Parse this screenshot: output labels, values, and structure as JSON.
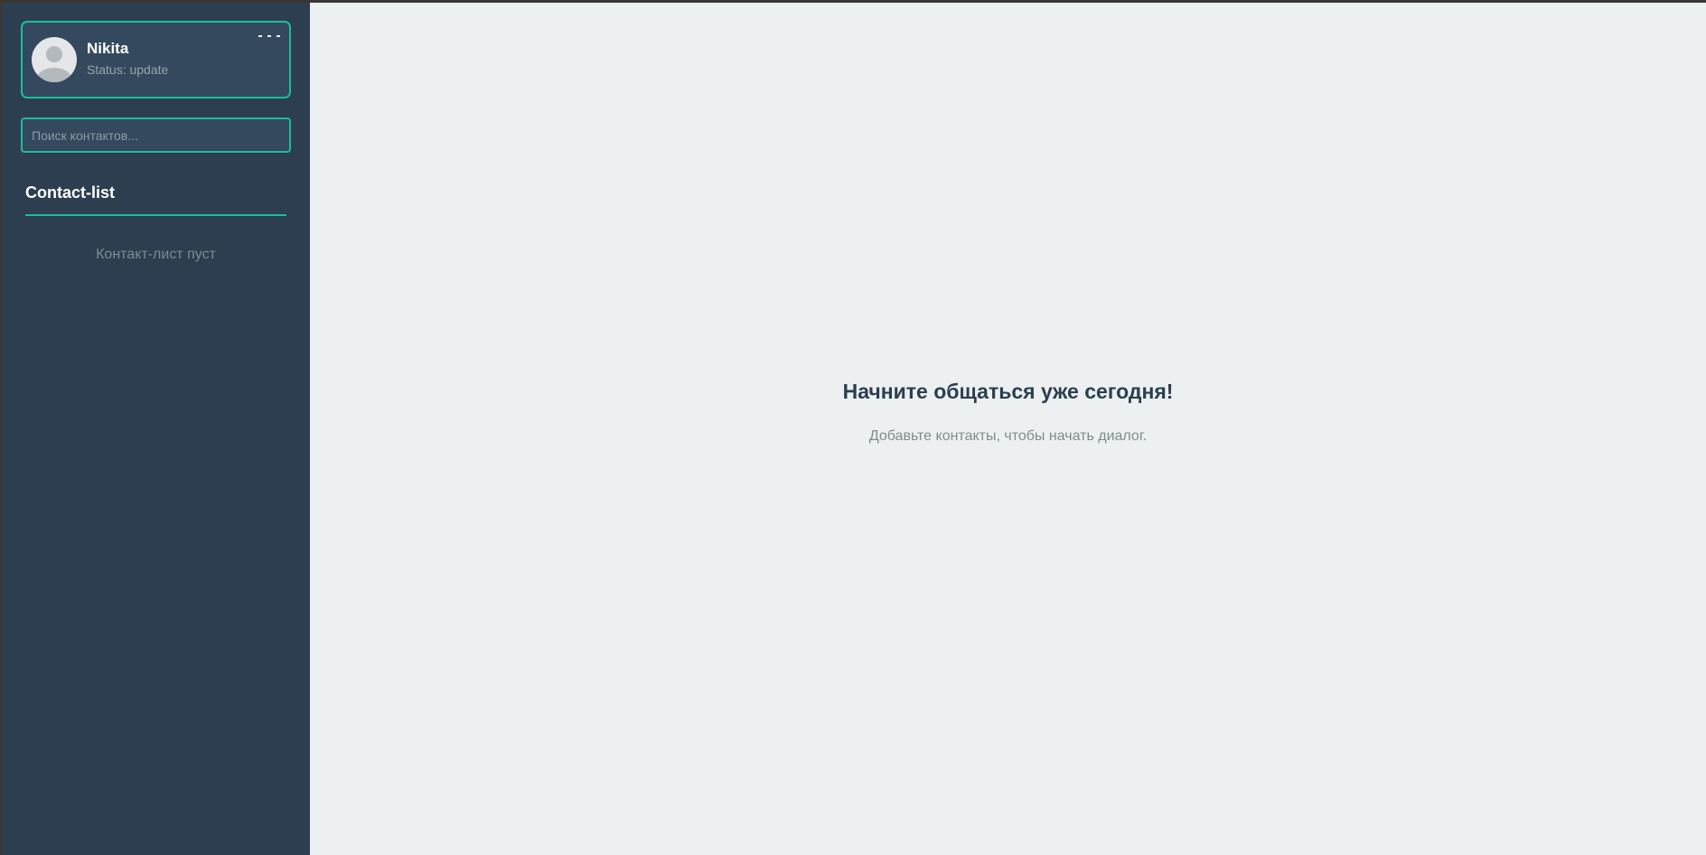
{
  "sidebar": {
    "profile": {
      "name": "Nikita",
      "status": "Status: update",
      "avatar_icon": "user-avatar-icon",
      "menu_icon": "more-horizontal-icon"
    },
    "search": {
      "placeholder": "Поиск контактов...",
      "value": ""
    },
    "contacts": {
      "title": "Contact-list",
      "empty_text": "Контакт-лист пуст",
      "items": []
    }
  },
  "main": {
    "welcome_title": "Начните общаться уже сегодня!",
    "welcome_subtitle": "Добавьте контакты, чтобы начать диалог."
  },
  "colors": {
    "sidebar_bg": "#2c3e50",
    "card_bg": "#34495e",
    "accent": "#1abc9c",
    "main_bg": "#ecf0f1",
    "muted_text": "#7f8c8d"
  }
}
